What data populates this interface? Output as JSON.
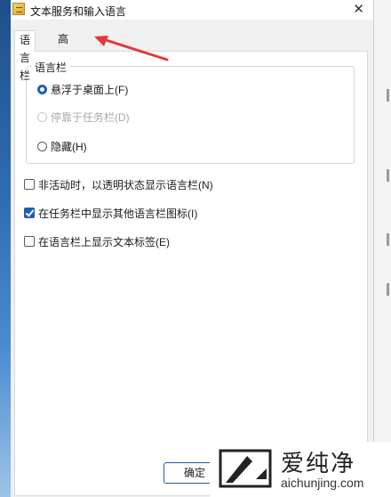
{
  "window": {
    "title": "文本服务和输入语言",
    "close_glyph": "✕"
  },
  "tabs": [
    {
      "label": "语言栏",
      "selected": true
    },
    {
      "label": "高级键设置",
      "selected": false
    }
  ],
  "language_bar": {
    "legend": "语言栏",
    "options": [
      {
        "label": "悬浮于桌面上(F)",
        "checked": true,
        "enabled": true
      },
      {
        "label": "停靠于任务栏(D)",
        "checked": false,
        "enabled": false
      },
      {
        "label": "隐藏(H)",
        "checked": false,
        "enabled": true
      }
    ]
  },
  "checkboxes": [
    {
      "label": "非活动时，以透明状态显示语言栏(N)",
      "checked": false
    },
    {
      "label": "在任务栏中显示其他语言栏图标(I)",
      "checked": true
    },
    {
      "label": "在语言栏上显示文本标签(E)",
      "checked": false
    }
  ],
  "footer": {
    "ok_label": "确定"
  },
  "annotation": {
    "arrow_color": "#e03a3a",
    "points_to": "高级键设置"
  },
  "watermark": {
    "name": "爱纯净",
    "url": "aichunjing.com"
  },
  "colors": {
    "accent": "#1f5fb0",
    "dialog_bg": "#f0f0f0",
    "panel_bg": "#ffffff"
  }
}
